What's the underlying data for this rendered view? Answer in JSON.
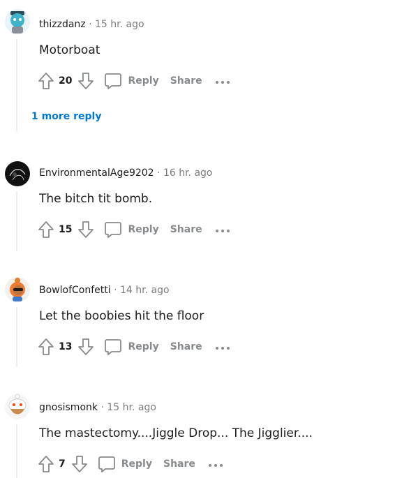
{
  "comments": [
    {
      "username": "thizzdanz",
      "separator": "·",
      "time": "15 hr. ago",
      "body": "Motorboat",
      "score": "20",
      "reply_label": "Reply",
      "share_label": "Share",
      "more_replies": "1 more reply"
    },
    {
      "username": "EnvironmentalAge9202",
      "separator": "·",
      "time": "16 hr. ago",
      "body": "The bitch tit bomb.",
      "score": "15",
      "reply_label": "Reply",
      "share_label": "Share"
    },
    {
      "username": "BowlofConfetti",
      "separator": "·",
      "time": "14 hr. ago",
      "body": "Let the boobies hit the floor",
      "score": "13",
      "reply_label": "Reply",
      "share_label": "Share"
    },
    {
      "username": "gnosismonk",
      "separator": "·",
      "time": "15 hr. ago",
      "body": "The mastectomy....Jiggle Drop... The Jigglier....",
      "score": "7",
      "reply_label": "Reply",
      "share_label": "Share"
    }
  ],
  "icons": {
    "upvote": "upvote-arrow-icon",
    "downvote": "downvote-arrow-icon",
    "comment": "speech-bubble-icon",
    "more": "ellipsis-icon"
  },
  "colors": {
    "link_blue": "#0079d3",
    "muted_gray": "#878a8c",
    "text": "#1c1c1c",
    "thread_line": "#edeff1"
  }
}
